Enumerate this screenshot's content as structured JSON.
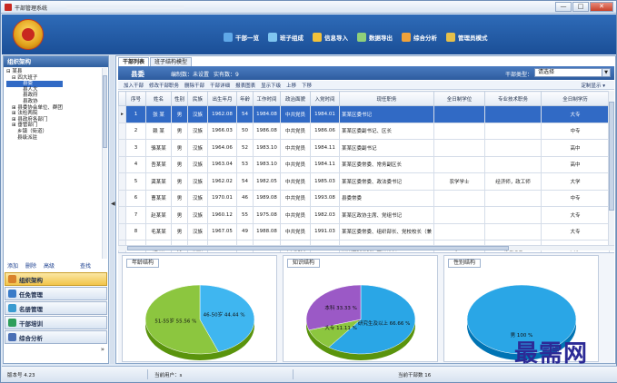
{
  "window": {
    "title": "干部管理系统",
    "min_label": "—",
    "max_label": "□",
    "close_label": "✕"
  },
  "toolbar": {
    "items": [
      {
        "label": "干部一览",
        "icon": "list-icon",
        "color": "#5fa8e8"
      },
      {
        "label": "班子组成",
        "icon": "group-icon",
        "color": "#7fc6f0"
      },
      {
        "label": "信息导入",
        "icon": "import-icon",
        "color": "#f2c23a"
      },
      {
        "label": "数据导出",
        "icon": "export-icon",
        "color": "#8fd07a"
      },
      {
        "label": "综合分析",
        "icon": "analysis-icon",
        "color": "#f0a23a"
      },
      {
        "label": "管理员模式",
        "icon": "admin-icon",
        "color": "#e6c04a"
      }
    ]
  },
  "left": {
    "title": "组织架构",
    "tree": [
      {
        "label": "⊟ 某县",
        "level": 1
      },
      {
        "label": "⊟ 四大班子",
        "level": 2
      },
      {
        "label": "县委",
        "level": 4,
        "selected": true
      },
      {
        "label": "县人大",
        "level": 4
      },
      {
        "label": "县政府",
        "level": 4
      },
      {
        "label": "县政协",
        "level": 4
      },
      {
        "label": "⊞ 县委协会单位、群团",
        "level": 2
      },
      {
        "label": "⊞ 法检两院",
        "level": 2
      },
      {
        "label": "⊞ 县政府各部门",
        "level": 2
      },
      {
        "label": "⊞ 垂管部门",
        "level": 2
      },
      {
        "label": "乡镇（街道）",
        "level": 3
      },
      {
        "label": "县级派驻",
        "level": 3
      }
    ],
    "actions": [
      "添加",
      "删除",
      "高级",
      "查找"
    ],
    "nav": [
      {
        "label": "组织架构",
        "icon": "org-icon",
        "color": "#d9822b",
        "active": true
      },
      {
        "label": "任免管理",
        "icon": "appoint-icon",
        "color": "#3a7bc8",
        "active": false
      },
      {
        "label": "名册管理",
        "icon": "roster-icon",
        "color": "#3a9bd0",
        "active": false
      },
      {
        "label": "干部培训",
        "icon": "training-icon",
        "color": "#2e9e5a",
        "active": false
      },
      {
        "label": "综合分析",
        "icon": "analysis-icon",
        "color": "#4a6fb5",
        "active": false
      }
    ],
    "more_label": "»"
  },
  "main": {
    "tabs": [
      "干部列表",
      "班子结构模型"
    ],
    "dept": "县委",
    "staffing": "编制数：未设置",
    "actual": "实有数：9",
    "type_label": "干部类型：",
    "type_value": "请选择",
    "actions": [
      "加入干部",
      "修改干部职务",
      "删除干部",
      "干部详细",
      "报表图表",
      "显示下级",
      "上移",
      "下移"
    ],
    "custom_display": "定制显示 ▾"
  },
  "table": {
    "columns": [
      "序号",
      "姓名",
      "性别",
      "民族",
      "出生年月",
      "年龄",
      "工作时间",
      "政治面貌",
      "入党时间",
      "现任职务",
      "全日制学位",
      "专业技术职务",
      "全日制学历"
    ],
    "rows": [
      [
        "1",
        "张 某",
        "男",
        "汉族",
        "1962.08",
        "54",
        "1984.08",
        "中共党员",
        "1984.01",
        "某某区委书记",
        "",
        "",
        "大专"
      ],
      [
        "2",
        "赖 某",
        "男",
        "汉族",
        "1966.03",
        "50",
        "1986.08",
        "中共党员",
        "1986.06",
        "某某区委副书记、区长",
        "",
        "",
        "中专"
      ],
      [
        "3",
        "骆某某",
        "男",
        "汉族",
        "1964.06",
        "52",
        "1983.10",
        "中共党员",
        "1984.11",
        "某某区委副书记",
        "",
        "",
        "高中"
      ],
      [
        "4",
        "吾某某",
        "男",
        "汉族",
        "1963.04",
        "53",
        "1983.10",
        "中共党员",
        "1984.11",
        "某某区委常委、常务副区长",
        "",
        "",
        "高中"
      ],
      [
        "5",
        "龚某某",
        "男",
        "汉族",
        "1962.02",
        "54",
        "1982.05",
        "中共党员",
        "1985.03",
        "某某区委常委、政法委书记",
        "农学学士",
        "经济师，政工师",
        "大学"
      ],
      [
        "6",
        "曹某某",
        "男",
        "汉族",
        "1970.01",
        "46",
        "1989.08",
        "中共党员",
        "1993.08",
        "县委常委",
        "",
        "",
        "中专"
      ],
      [
        "7",
        "赵某某",
        "男",
        "汉族",
        "1960.12",
        "55",
        "1975.08",
        "中共党员",
        "1982.03",
        "某某区政协主席、党组书记",
        "",
        "",
        "大专"
      ],
      [
        "8",
        "毛某某",
        "男",
        "汉族",
        "1967.05",
        "49",
        "1988.08",
        "中共党员",
        "1991.03",
        "某某区委常委、组织部长、党校校长（兼",
        "",
        "",
        "大专"
      ],
      [
        "9",
        "汪 某",
        "男",
        "汉族",
        "1970.01",
        "46",
        "1992.08",
        "中共党员",
        "1996.04",
        "某某区委常委，宣传部长",
        "学士",
        "助理记者",
        "大学"
      ]
    ]
  },
  "chart_data": [
    {
      "type": "pie",
      "title": "年龄结构",
      "labels": [
        "46-50岁",
        "51-55岁"
      ],
      "values": [
        44.44,
        55.56
      ],
      "value_labels": [
        "46-50岁 44.44 %",
        "51-55岁 55.56 %"
      ],
      "colors": [
        "#3fb6f0",
        "#8cc63f"
      ]
    },
    {
      "type": "pie",
      "title": "知识结构",
      "labels": [
        "研究生及以上",
        "大专",
        "本科"
      ],
      "values": [
        66.66,
        11.11,
        33.33
      ],
      "value_labels": [
        "研究生及以上 66.66 %",
        "大专 11.11 %",
        "本科 33.33 %"
      ],
      "colors": [
        "#2aa6e6",
        "#8cc63f",
        "#9b59c6"
      ]
    },
    {
      "type": "pie",
      "title": "性别结构",
      "labels": [
        "男"
      ],
      "values": [
        100
      ],
      "value_labels": [
        "男 100 %"
      ],
      "colors": [
        "#2aa6e6"
      ]
    }
  ],
  "status": {
    "version": "版本号 4.23",
    "current_user": "当前用户：s",
    "current_count": "当前干部数 16"
  },
  "watermark": "最需网"
}
